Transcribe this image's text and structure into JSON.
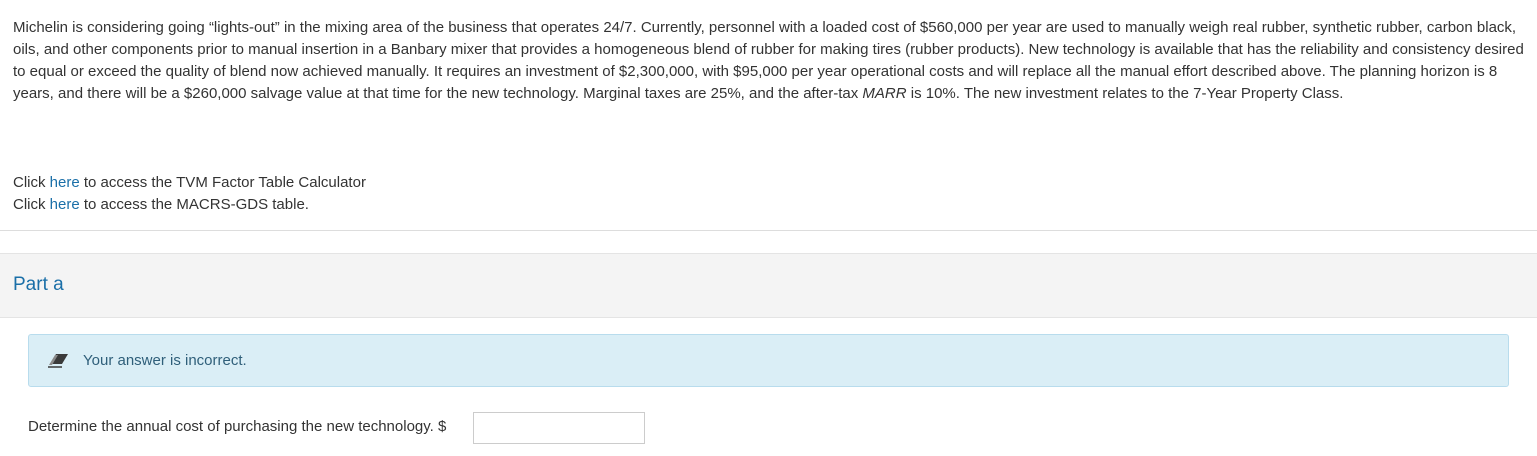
{
  "problem": {
    "text_1": "Michelin is considering going “lights-out” in the mixing area of the business that operates 24/7. Currently, personnel with a loaded cost of $560,000 per year are used to manually weigh real rubber, synthetic rubber, carbon black, oils, and other components prior to manual insertion in a Banbary mixer that provides a homogeneous blend of rubber for making tires (rubber products). New technology is available that has the reliability and consistency desired to equal or exceed the quality of blend now achieved manually. It requires an investment of $2,300,000, with $95,000 per year operational costs and will replace all the manual effort described above. The planning horizon is 8 years, and there will be a $260,000 salvage value at that time for the new technology. Marginal taxes are 25%, and the after-tax ",
    "marr": "MARR",
    "text_2": " is 10%. The new investment relates to the 7-Year Property Class."
  },
  "links": {
    "tvm": {
      "prefix": "Click ",
      "link": "here",
      "suffix": " to access the TVM Factor Table Calculator"
    },
    "macrs": {
      "prefix": "Click ",
      "link": "here",
      "suffix": " to access the MACRS-GDS table."
    }
  },
  "part": {
    "title": "Part a"
  },
  "feedback": {
    "message": "Your answer is incorrect.",
    "icon": "eraser-icon"
  },
  "question": {
    "text": "Determine the annual cost of purchasing the new technology. $",
    "answer_value": ""
  },
  "colors": {
    "link": "#1a6fa8",
    "feedback_bg": "#daeef6"
  }
}
